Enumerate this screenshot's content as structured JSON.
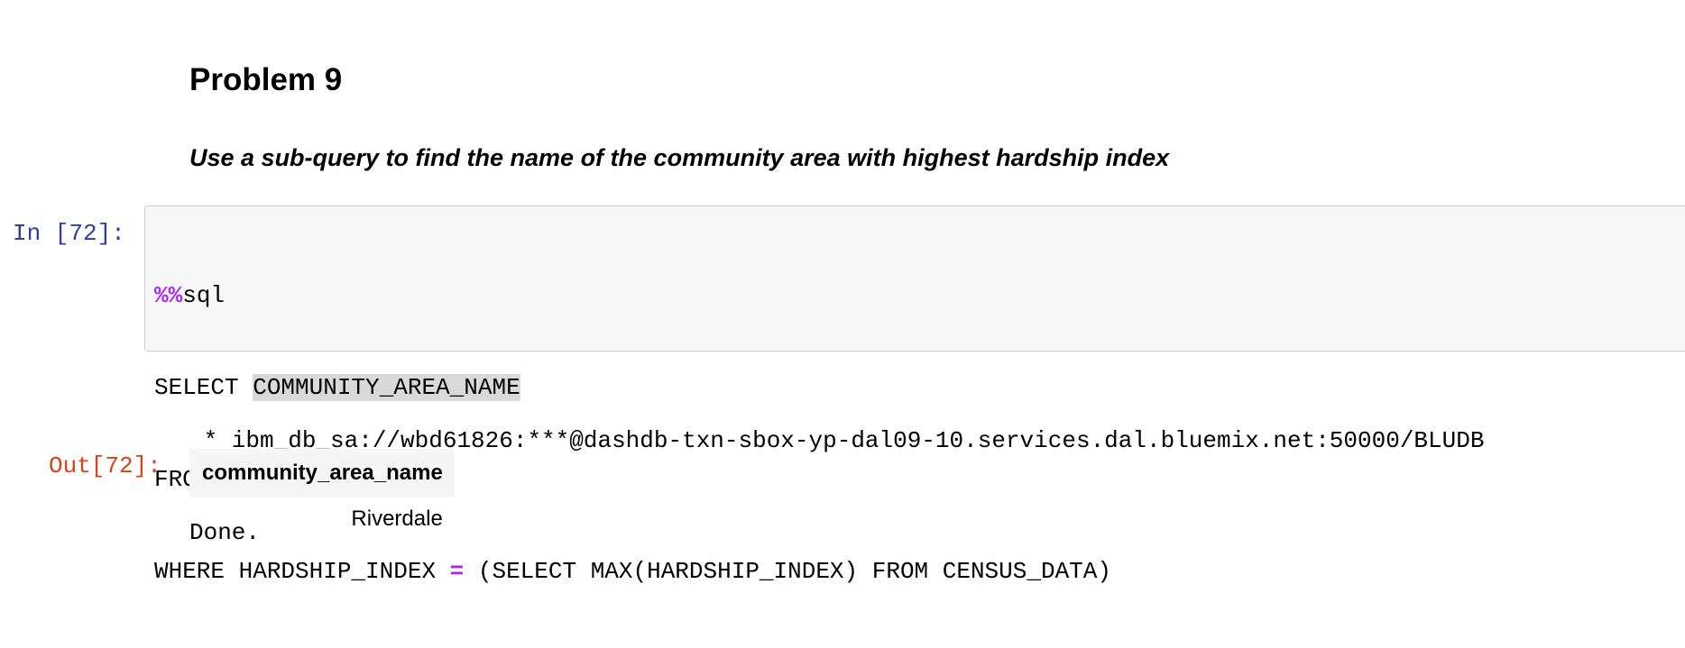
{
  "markdown": {
    "heading": "Problem 9",
    "subtitle": "Use a sub-query to find the name of the community area with highest hardship index"
  },
  "input_cell": {
    "prompt": "In [72]:",
    "code": {
      "magic_prefix": "%%",
      "magic_name": "sql",
      "line2_keyword": "SELECT ",
      "line2_selected": "COMMUNITY_AREA_NAME",
      "line3": "FROM CENSUS_DATA",
      "line4_before_op": "WHERE HARDSHIP_INDEX ",
      "line4_op": "=",
      "line4_after_op": " (SELECT MAX(HARDSHIP_INDEX) FROM CENSUS_DATA)"
    }
  },
  "stream_output": {
    "connection_line": " * ibm_db_sa://wbd61826:***@dashdb-txn-sbox-yp-dal09-10.services.dal.bluemix.net:50000/BLUDB",
    "status_line": "Done."
  },
  "output_cell": {
    "prompt": "Out[72]:",
    "table": {
      "columns": [
        "community_area_name"
      ],
      "rows": [
        [
          "Riverdale"
        ]
      ]
    }
  },
  "colors": {
    "in_prompt": "#303f9f",
    "out_prompt": "#d84315",
    "magic_operator": "#aa22ff",
    "code_background": "#f7f7f7",
    "selection_highlight": "#d9d9d9"
  }
}
